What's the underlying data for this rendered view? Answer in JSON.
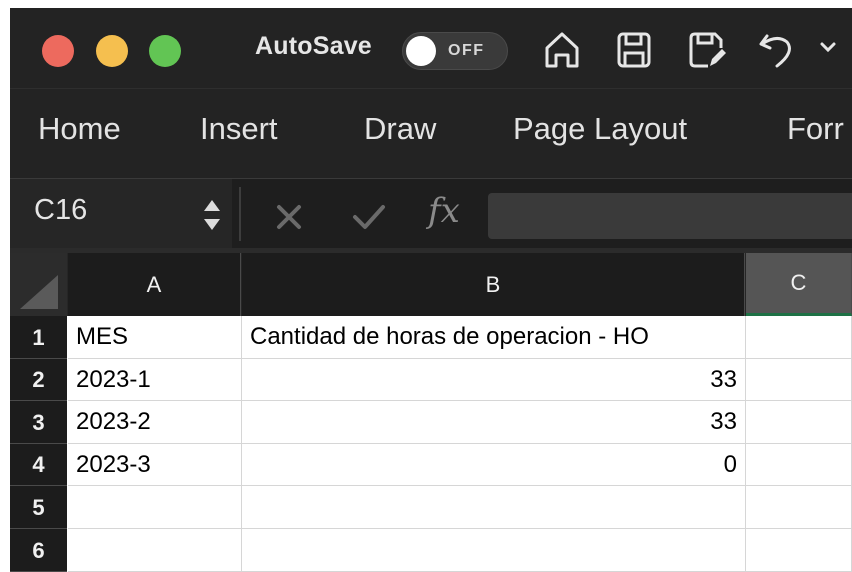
{
  "titlebar": {
    "autosave_label": "AutoSave",
    "autosave_state": "OFF",
    "icons": [
      "home-icon",
      "save-icon",
      "save-as-icon",
      "undo-icon",
      "chevron-down-icon"
    ]
  },
  "ribbon": {
    "tabs": [
      "Home",
      "Insert",
      "Draw",
      "Page Layout",
      "Forr"
    ]
  },
  "formula_bar": {
    "name_box": "C16",
    "fx_label": "fx",
    "formula_value": ""
  },
  "sheet": {
    "columns": [
      "A",
      "B",
      "C"
    ],
    "rows": [
      {
        "num": "1",
        "a": "MES",
        "b": "Cantidad de horas de operacion - HO",
        "c": ""
      },
      {
        "num": "2",
        "a": "2023-1",
        "b": "33",
        "c": ""
      },
      {
        "num": "3",
        "a": "2023-2",
        "b": "33",
        "c": ""
      },
      {
        "num": "4",
        "a": "2023-3",
        "b": "0",
        "c": ""
      },
      {
        "num": "5",
        "a": "",
        "b": "",
        "c": ""
      },
      {
        "num": "6",
        "a": "",
        "b": "",
        "c": ""
      }
    ]
  },
  "colors": {
    "close": "#ed6a5e",
    "minimize": "#f5bf4f",
    "zoom": "#62c554",
    "selected_column_accent": "#1e7145"
  }
}
